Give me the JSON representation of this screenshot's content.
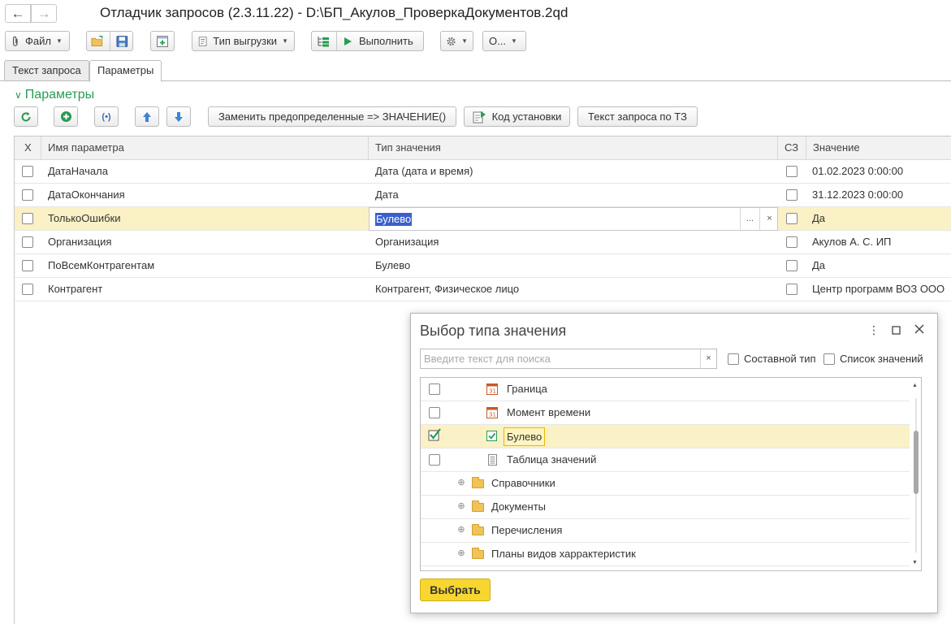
{
  "window": {
    "title": "Отладчик запросов (2.3.11.22) - D:\\БП_Акулов_ПроверкаДокументов.2qd"
  },
  "toolbar": {
    "file_label": "Файл",
    "export_type_label": "Тип выгрузки",
    "run_label": "Выполнить",
    "more_label": "О..."
  },
  "tabs": [
    {
      "label": "Текст запроса",
      "active": false
    },
    {
      "label": "Параметры",
      "active": true
    }
  ],
  "params_group": {
    "title": "Параметры",
    "replace_button": "Заменить предопределенные => ЗНАЧЕНИЕ()",
    "install_code_button": "Код установки",
    "query_by_vt_button": "Текст запроса по ТЗ"
  },
  "grid": {
    "columns": [
      "Х",
      "Имя параметра",
      "Тип значения",
      "СЗ",
      "Значение"
    ],
    "rows": [
      {
        "name": "ДатаНачала",
        "type": "Дата (дата и время)",
        "value": "01.02.2023 0:00:00"
      },
      {
        "name": "ДатаОкончания",
        "type": "Дата",
        "value": "31.12.2023 0:00:00"
      },
      {
        "name": "ТолькоОшибки",
        "type": "Булево",
        "value": "Да",
        "selected": true
      },
      {
        "name": "Организация",
        "type": "Организация",
        "value": "Акулов А. С. ИП"
      },
      {
        "name": "ПоВсемКонтрагентам",
        "type": "Булево",
        "value": "Да"
      },
      {
        "name": "Контрагент",
        "type": "Контрагент, Физическое лицо",
        "value": "Центр программ ВОЗ ООО"
      }
    ],
    "editor_dots": "...",
    "editor_clear": "×"
  },
  "dialog": {
    "title": "Выбор типа значения",
    "search_placeholder": "Введите текст для поиска",
    "clear_glyph": "×",
    "composite_type_label": "Составной тип",
    "value_list_label": "Список значений",
    "items": [
      {
        "label": "Граница",
        "checked": false
      },
      {
        "label": "Момент времени",
        "checked": false
      },
      {
        "label": "Булево",
        "checked": true
      },
      {
        "label": "Таблица значений",
        "checked": false
      }
    ],
    "folders": [
      "Справочники",
      "Документы",
      "Перечисления",
      "Планы видов харрактеристик"
    ],
    "select_button": "Выбрать"
  },
  "colors": {
    "accent_green": "#2a9a55",
    "selected_row": "#fbf1c6",
    "primary_button": "#f7d631",
    "text_highlight": "#3a5fcd"
  }
}
